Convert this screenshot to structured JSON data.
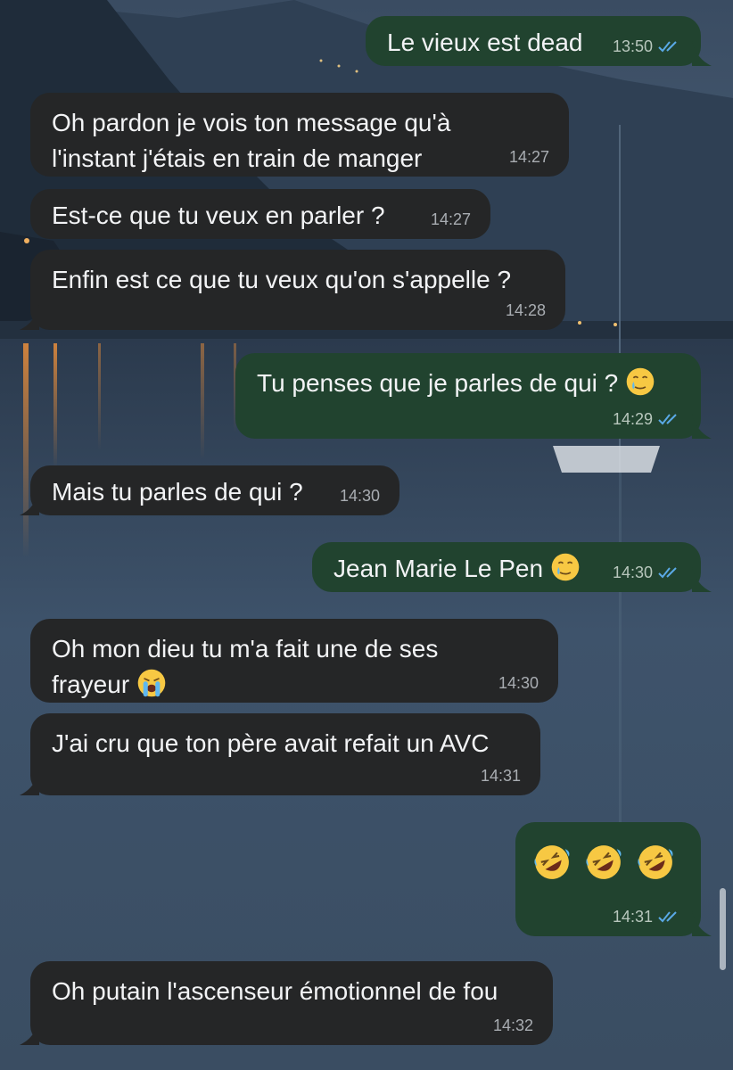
{
  "messages": [
    {
      "id": "m1",
      "side": "out",
      "lines": [
        "Le vieux est dead"
      ],
      "time": "13:50"
    },
    {
      "id": "m2",
      "side": "in",
      "lines": [
        "Oh pardon je vois ton message qu'à",
        "l'instant j'étais en train de manger"
      ],
      "time": "14:27"
    },
    {
      "id": "m3",
      "side": "in",
      "lines": [
        "Est-ce que tu veux en parler ?"
      ],
      "time": "14:27"
    },
    {
      "id": "m4",
      "side": "in",
      "lines": [
        "Enfin est ce que tu veux qu'on s'appelle ?"
      ],
      "time": "14:28"
    },
    {
      "id": "m5",
      "side": "out",
      "lines": [
        "Tu penses que je parles de qui ?"
      ],
      "emoji": "holding-back-tears-emoji",
      "time": "14:29"
    },
    {
      "id": "m6",
      "side": "in",
      "lines": [
        "Mais tu parles de qui ?"
      ],
      "time": "14:30"
    },
    {
      "id": "m7",
      "side": "out",
      "lines": [
        "Jean Marie Le Pen"
      ],
      "emoji": "holding-back-tears-emoji",
      "time": "14:30"
    },
    {
      "id": "m8",
      "side": "in",
      "lines": [
        "Oh mon dieu tu m'a fait une de ses",
        "frayeur"
      ],
      "emoji": "loudly-crying-emoji",
      "time": "14:30"
    },
    {
      "id": "m9",
      "side": "in",
      "lines": [
        "J'ai cru que ton père avait refait un AVC"
      ],
      "time": "14:31"
    },
    {
      "id": "m10",
      "side": "out",
      "emojis": [
        "rolling-on-floor-laughing-emoji",
        "rolling-on-floor-laughing-emoji",
        "rolling-on-floor-laughing-emoji"
      ],
      "time": "14:31"
    },
    {
      "id": "m11",
      "side": "in",
      "lines": [
        "Oh putain l'ascenseur émotionnel de fou"
      ],
      "time": "14:32"
    }
  ],
  "colors": {
    "incoming_bubble": "#252627",
    "outgoing_bubble": "#21432f",
    "read_ticks": "#5aa9e6"
  }
}
